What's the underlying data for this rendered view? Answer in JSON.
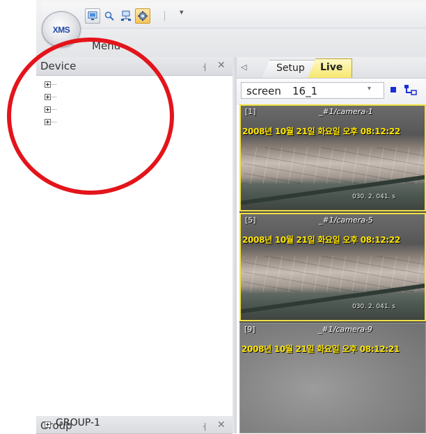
{
  "app": {
    "logo_text": "XMS"
  },
  "ribbon": {
    "menu_label": "Menu",
    "qat_more": "▾"
  },
  "device_panel": {
    "title": "Device",
    "pin_glyph": "ㅓ",
    "close_glyph": "✕",
    "tree_items": [
      "",
      "",
      "",
      ""
    ]
  },
  "group_panel": {
    "title": "Group",
    "pin_glyph": "ㅓ",
    "close_glyph": "✕",
    "items": [
      "GROUP-1"
    ]
  },
  "tabs": {
    "scroll_glyph": "◁",
    "items": [
      {
        "label": "Setup",
        "active": false
      },
      {
        "label": "Live",
        "active": true
      }
    ]
  },
  "screen_selector": {
    "label": "screen",
    "value": "16_1",
    "arrow": "▾"
  },
  "cameras": [
    {
      "index": "[1]",
      "name": "_#1/camera-1",
      "timestamp": "2008년 10월 21일 화요일 오후 08:12:22",
      "stamp": "030. 2. 041. s",
      "selected": true
    },
    {
      "index": "[5]",
      "name": "_#1/camera-5",
      "timestamp": "2008년 10월 21일 화요일 오후 08:12:22",
      "stamp": "030. 2. 041. s",
      "selected": true
    },
    {
      "index": "[9]",
      "name": "_#1/camera-9",
      "timestamp": "2008년 10월 21일 화요일 오후 08:12:21",
      "stamp": "",
      "selected": false
    }
  ],
  "colors": {
    "annotation_circle": "#e4141b",
    "live_tab": "#f6e66a",
    "selected_frame": "#f2e245",
    "timestamp_text": "#ffe600"
  },
  "icons": {
    "qat": [
      "monitor-icon",
      "search-icon",
      "network-icon",
      "settings-gear-icon"
    ],
    "toolbar": [
      "stop-square-icon",
      "tree-layout-icon"
    ]
  }
}
